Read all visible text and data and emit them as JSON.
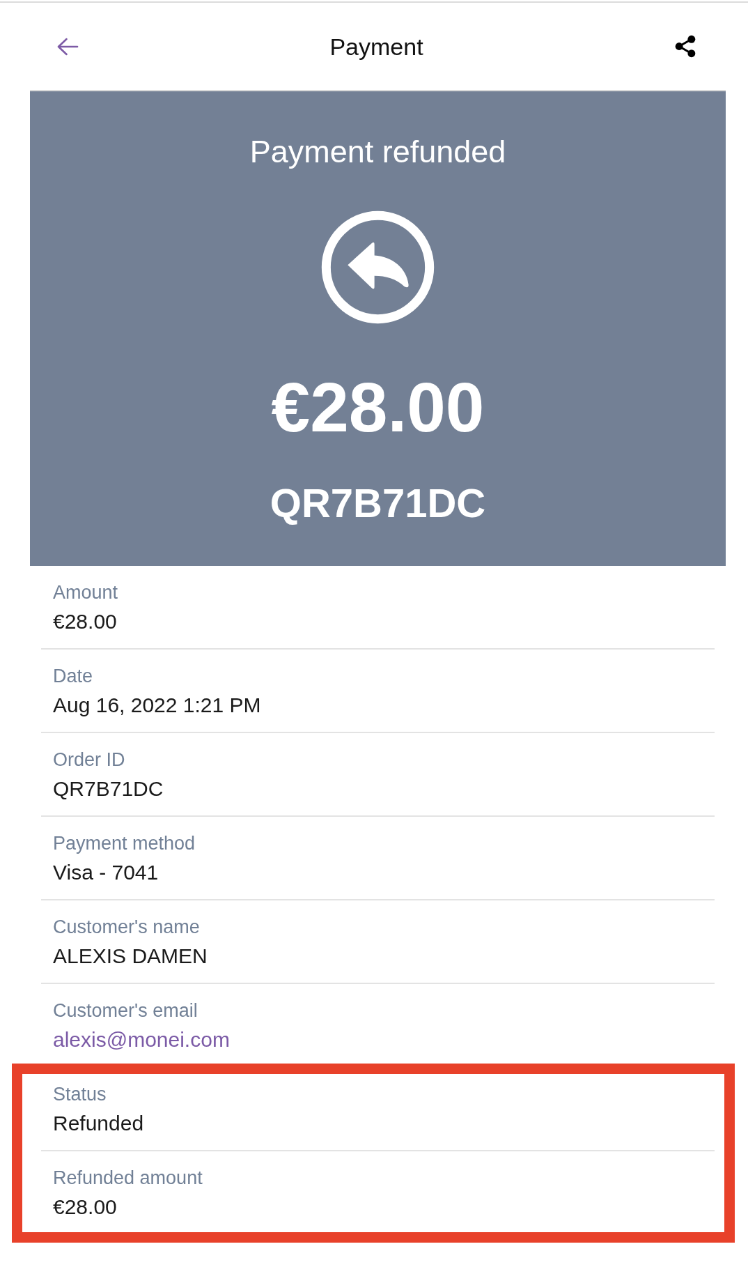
{
  "header": {
    "title": "Payment"
  },
  "banner": {
    "kind": "refunded",
    "status": "Payment refunded",
    "amount": "€28.00",
    "reference": "QR7B71DC"
  },
  "details": [
    {
      "label": "Amount",
      "value": "€28.00",
      "kind": "text",
      "highlighted": false
    },
    {
      "label": "Date",
      "value": "Aug 16, 2022 1:21 PM",
      "kind": "text",
      "highlighted": false
    },
    {
      "label": "Order ID",
      "value": "QR7B71DC",
      "kind": "text",
      "highlighted": false
    },
    {
      "label": "Payment method",
      "value": "Visa - 7041",
      "kind": "text",
      "highlighted": false
    },
    {
      "label": "Customer's name",
      "value": "ALEXIS DAMEN",
      "kind": "text",
      "highlighted": false
    },
    {
      "label": "Customer's email",
      "value": "alexis@monei.com",
      "kind": "link",
      "highlighted": false
    },
    {
      "label": "Status",
      "value": "Refunded",
      "kind": "text",
      "highlighted": true
    },
    {
      "label": "Refunded amount",
      "value": "€28.00",
      "kind": "text",
      "highlighted": true
    }
  ]
}
